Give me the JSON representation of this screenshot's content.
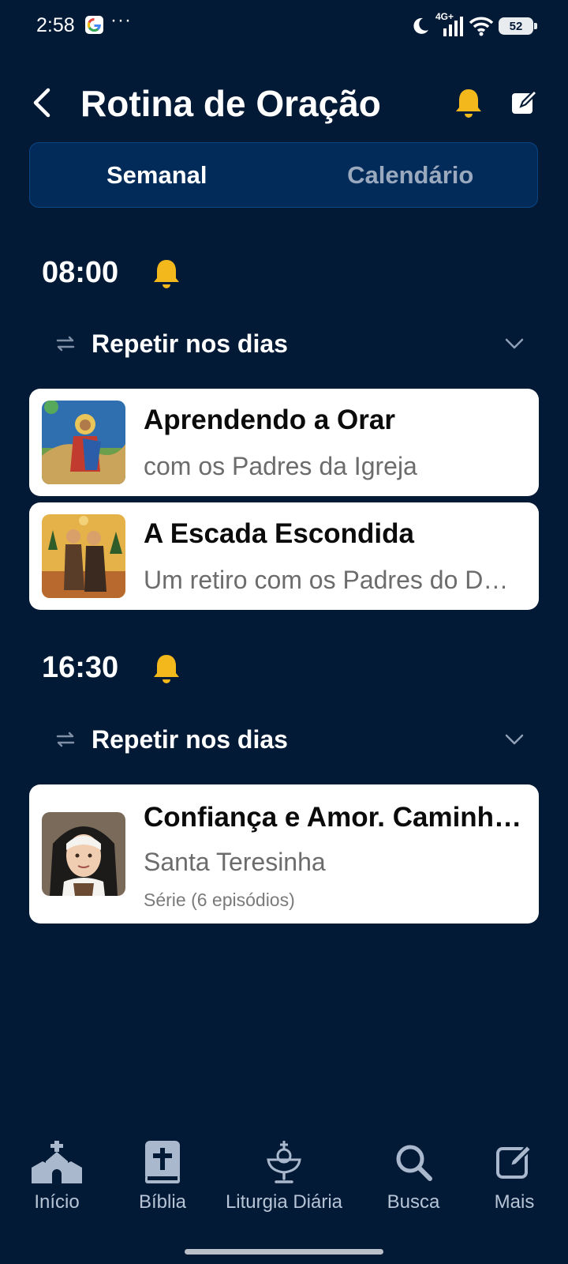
{
  "status_bar": {
    "time": "2:58",
    "overflow": "···",
    "network": "4G+",
    "battery": "52",
    "icons": [
      "google-icon",
      "moon-icon",
      "signal-icon",
      "wifi-icon",
      "battery-icon"
    ]
  },
  "header": {
    "title": "Rotina de Oração",
    "icons": [
      "back-arrow-icon",
      "bell-icon",
      "edit-icon"
    ]
  },
  "tabs": [
    {
      "label": "Semanal",
      "selected": true
    },
    {
      "label": "Calendário",
      "selected": false
    }
  ],
  "schedules": [
    {
      "time": "08:00",
      "repeat_label": "Repetir nos dias",
      "items": [
        {
          "title": "Aprendendo a Orar",
          "subtitle": "com os Padres da Igreja"
        },
        {
          "title": "A Escada Escondida",
          "subtitle": "Um retiro com os Padres do Deserto"
        }
      ]
    },
    {
      "time": "16:30",
      "repeat_label": "Repetir nos dias",
      "items": [
        {
          "title": "Confiança e Amor. Caminho de Santidade",
          "subtitle": "Santa Teresinha",
          "meta": "Série (6 episódios)"
        }
      ]
    }
  ],
  "bottom_nav": [
    {
      "label": "Início",
      "icon": "church-icon"
    },
    {
      "label": "Bíblia",
      "icon": "bible-icon"
    },
    {
      "label": "Liturgia Diária",
      "icon": "chalice-icon"
    },
    {
      "label": "Busca",
      "icon": "search-icon"
    },
    {
      "label": "Mais",
      "icon": "edit-icon"
    }
  ],
  "colors": {
    "background": "#021a36",
    "tab_bar": "#022b5a",
    "accent_bell": "#f2b81c",
    "card": "#ffffff",
    "nav_icon": "#a9b8cc"
  }
}
